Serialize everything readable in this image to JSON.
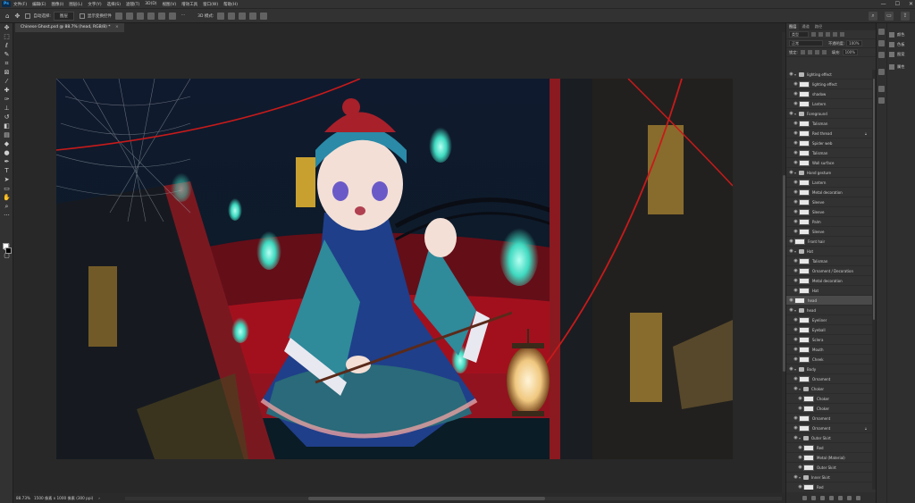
{
  "menu": {
    "logo": "Ps",
    "items": [
      "文件(F)",
      "编辑(E)",
      "图像(I)",
      "图层(L)",
      "文字(Y)",
      "选择(S)",
      "滤镜(T)",
      "3D(D)",
      "视图(V)",
      "增效工具",
      "窗口(W)",
      "帮助(H)"
    ]
  },
  "window": {
    "minimize": "—",
    "maximize": "☐",
    "close": "✕"
  },
  "options": {
    "auto_select_label": "自动选择:",
    "auto_select_target": "图层",
    "transform_controls_label": "显示变换控件",
    "more": "···",
    "mode_3d": "3D 模式:"
  },
  "document": {
    "tab_title": "Chinese Ghost.psd @ 88.7% (head, RGB/8) *",
    "tab_close": "×"
  },
  "status": {
    "zoom": "88.73%",
    "info": "1500 像素 x 1000 像素 (300 ppi)",
    "arrow": "›"
  },
  "panel": {
    "tabs": [
      "图层",
      "通道",
      "路径"
    ],
    "kind_filter": "类型",
    "blend_mode": "正常",
    "opacity_label": "不透明度:",
    "opacity_value": "100%",
    "lock_label": "锁定:",
    "fill_label": "填充:",
    "fill_value": "100%"
  },
  "layers": [
    {
      "name": "lighting effect",
      "type": "group",
      "indent": 0,
      "open": true
    },
    {
      "name": "lighting effect",
      "type": "layer",
      "indent": 1
    },
    {
      "name": "shadow",
      "type": "layer",
      "indent": 1
    },
    {
      "name": "Lantern",
      "type": "layer",
      "indent": 1
    },
    {
      "name": "Foreground",
      "type": "group",
      "indent": 0,
      "open": true
    },
    {
      "name": "Talisman",
      "type": "layer",
      "indent": 1
    },
    {
      "name": "Red thread",
      "type": "layer",
      "indent": 1,
      "locked": true
    },
    {
      "name": "Spider web",
      "type": "layer",
      "indent": 1
    },
    {
      "name": "Talisman",
      "type": "layer",
      "indent": 1
    },
    {
      "name": "Wall surface",
      "type": "layer",
      "indent": 1
    },
    {
      "name": "Hand gesture",
      "type": "group",
      "indent": 0,
      "open": true
    },
    {
      "name": "Lantern",
      "type": "layer",
      "indent": 1
    },
    {
      "name": "Metal decoration",
      "type": "layer",
      "indent": 1
    },
    {
      "name": "Sleeve",
      "type": "layer",
      "indent": 1
    },
    {
      "name": "Sleeve",
      "type": "layer",
      "indent": 1
    },
    {
      "name": "Palm",
      "type": "layer",
      "indent": 1
    },
    {
      "name": "Sleeve",
      "type": "layer",
      "indent": 1
    },
    {
      "name": "Front hair",
      "type": "layer",
      "indent": 0
    },
    {
      "name": "Hat",
      "type": "group",
      "indent": 0,
      "open": true
    },
    {
      "name": "Talisman",
      "type": "layer",
      "indent": 1
    },
    {
      "name": "Ornament / Decoration",
      "type": "layer",
      "indent": 1
    },
    {
      "name": "Metal decoration",
      "type": "layer",
      "indent": 1
    },
    {
      "name": "Hat",
      "type": "layer",
      "indent": 1
    },
    {
      "name": "head",
      "type": "layer",
      "indent": 0,
      "selected": true
    },
    {
      "name": "head",
      "type": "group",
      "indent": 0,
      "open": true
    },
    {
      "name": "Eyeliner",
      "type": "layer",
      "indent": 1
    },
    {
      "name": "Eyeball",
      "type": "layer",
      "indent": 1
    },
    {
      "name": "Sclera",
      "type": "layer",
      "indent": 1
    },
    {
      "name": "Mouth",
      "type": "layer",
      "indent": 1
    },
    {
      "name": "Cheek",
      "type": "layer",
      "indent": 1
    },
    {
      "name": "Body",
      "type": "group",
      "indent": 0,
      "open": true
    },
    {
      "name": "Ornament",
      "type": "layer",
      "indent": 1
    },
    {
      "name": "Choker",
      "type": "group",
      "indent": 1,
      "open": true
    },
    {
      "name": "Choker",
      "type": "layer",
      "indent": 2
    },
    {
      "name": "Choker",
      "type": "layer",
      "indent": 2
    },
    {
      "name": "Ornament",
      "type": "layer",
      "indent": 1
    },
    {
      "name": "Ornament",
      "type": "layer",
      "indent": 1,
      "locked": true
    },
    {
      "name": "Outer Skirt",
      "type": "group",
      "indent": 1,
      "open": true
    },
    {
      "name": "Red",
      "type": "layer",
      "indent": 2
    },
    {
      "name": "Metal (Material)",
      "type": "layer",
      "indent": 2
    },
    {
      "name": "Outer Skirt",
      "type": "layer",
      "indent": 2
    },
    {
      "name": "Inner Skirt",
      "type": "group",
      "indent": 1,
      "open": true
    },
    {
      "name": "Red",
      "type": "layer",
      "indent": 2
    }
  ],
  "dock": [
    {
      "label": "颜色"
    },
    {
      "label": "色板"
    },
    {
      "label": "图案"
    },
    {
      "label": "属性"
    }
  ],
  "colors": {
    "accent": "#31a8ff",
    "panel_bg": "#323232",
    "canvas_bg": "#282828",
    "selected_layer": "#4a4a4a"
  }
}
